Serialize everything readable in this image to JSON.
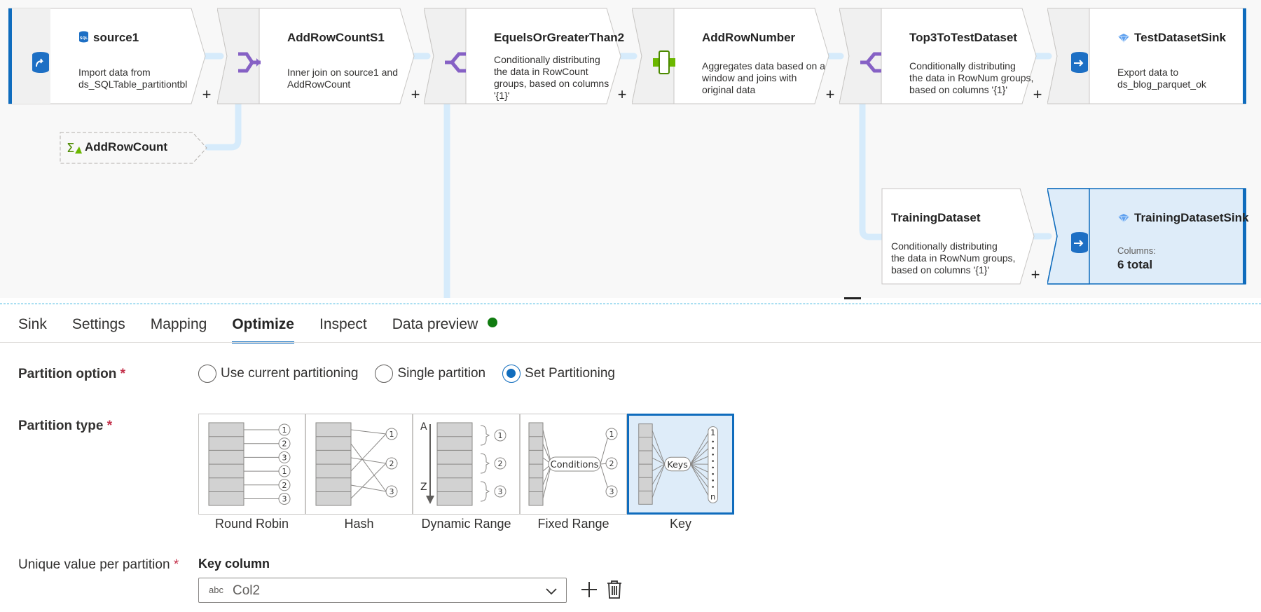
{
  "pipeline": {
    "nodes": [
      {
        "title": "source1",
        "desc": "Import data from\nds_SQLTable_partitiontbl",
        "icon": "sql-source-icon"
      },
      {
        "title": "AddRowCountS1",
        "desc": "Inner join on source1 and\nAddRowCount",
        "icon": "join-icon"
      },
      {
        "title": "EquelsOrGreaterThan2",
        "desc": "Conditionally distributing\nthe data in RowCount\ngroups, based on columns\n'{1}'",
        "icon": "conditional-split-icon"
      },
      {
        "title": "AddRowNumber",
        "desc": "Aggregates data based on a\nwindow and joins with\noriginal data",
        "icon": "window-icon"
      },
      {
        "title": "Top3ToTestDataset",
        "desc": "Conditionally distributing\nthe data in RowNum groups,\nbased on columns '{1}'",
        "icon": "conditional-split-icon"
      },
      {
        "title": "TestDatasetSink",
        "desc": "Export data to\nds_blog_parquet_ok",
        "icon": "sink-icon"
      }
    ],
    "aggregate": {
      "title": "AddRowCount",
      "icon": "aggregate-icon"
    },
    "training": {
      "title": "TrainingDataset",
      "desc": "Conditionally distributing\nthe data in RowNum groups,\nbased on columns '{1}'"
    },
    "training_sink": {
      "title": "TrainingDatasetSink",
      "columns_label": "Columns:",
      "columns_value": "6 total"
    },
    "plus": "+"
  },
  "tabs": [
    "Sink",
    "Settings",
    "Mapping",
    "Optimize",
    "Inspect",
    "Data preview"
  ],
  "active_tab": "Optimize",
  "status_color": "#107c10",
  "form": {
    "partition_option_label": "Partition option",
    "required_mark": "*",
    "partition_options": [
      "Use current partitioning",
      "Single partition",
      "Set Partitioning"
    ],
    "partition_option_selected": "Set Partitioning",
    "partition_type_label": "Partition type",
    "partition_types": [
      "Round Robin",
      "Hash",
      "Dynamic Range",
      "Fixed Range",
      "Key"
    ],
    "partition_type_selected": "Key",
    "diagram_text": {
      "rr_nums": [
        "1",
        "2",
        "3",
        "1",
        "2",
        "3"
      ],
      "hash_nums": [
        "1",
        "2",
        "3"
      ],
      "range_a": "A",
      "range_z": "Z",
      "conditions": "Conditions",
      "keys": "Keys",
      "key_n": "n"
    },
    "unique_label": "Unique value per partition",
    "key_column_title": "Key column",
    "key_column_type": "abc",
    "key_column_value": "Col2"
  },
  "colors": {
    "accent": "#0f6cbd",
    "selected_bg": "#deecf9",
    "flow_line": "#d6ebfb",
    "split_purple": "#8661c5"
  }
}
